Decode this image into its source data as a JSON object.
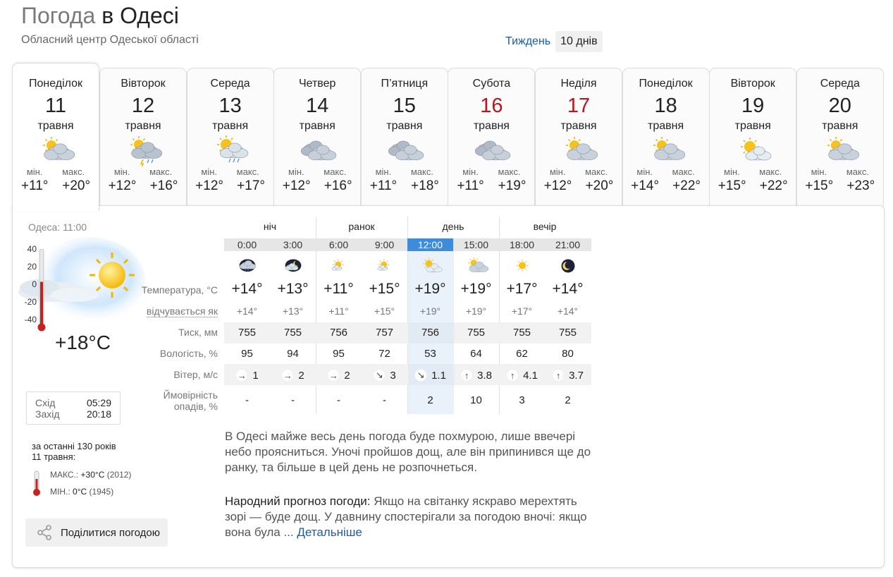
{
  "header": {
    "title_prefix": "Погода",
    "title_suffix": "в Одесі",
    "subtitle": "Обласний центр Одеської області",
    "view_tabs": [
      "Тиждень",
      "10 днів"
    ]
  },
  "days": [
    {
      "name": "Понеділок",
      "num": "11",
      "month": "травня",
      "icon": "cloudy-sun",
      "min_label": "мін.",
      "max_label": "макс.",
      "min": "+11°",
      "max": "+20°",
      "weekend": false,
      "active": true
    },
    {
      "name": "Вівторок",
      "num": "12",
      "month": "травня",
      "icon": "cloudy-sun-storm",
      "min_label": "мін.",
      "max_label": "макс.",
      "min": "+12°",
      "max": "+16°",
      "weekend": false
    },
    {
      "name": "Середа",
      "num": "13",
      "month": "травня",
      "icon": "sun-rain",
      "min_label": "мін.",
      "max_label": "макс.",
      "min": "+12°",
      "max": "+17°",
      "weekend": false
    },
    {
      "name": "Четвер",
      "num": "14",
      "month": "травня",
      "icon": "cloudy",
      "min_label": "мін.",
      "max_label": "макс.",
      "min": "+12°",
      "max": "+16°",
      "weekend": false
    },
    {
      "name": "П’ятниця",
      "num": "15",
      "month": "травня",
      "icon": "cloudy",
      "min_label": "мін.",
      "max_label": "макс.",
      "min": "+11°",
      "max": "+18°",
      "weekend": false
    },
    {
      "name": "Субота",
      "num": "16",
      "month": "травня",
      "icon": "cloudy",
      "min_label": "мін.",
      "max_label": "макс.",
      "min": "+11°",
      "max": "+19°",
      "weekend": true
    },
    {
      "name": "Неділя",
      "num": "17",
      "month": "травня",
      "icon": "cloudy-sun",
      "min_label": "мін.",
      "max_label": "макс.",
      "min": "+12°",
      "max": "+20°",
      "weekend": true
    },
    {
      "name": "Понеділок",
      "num": "18",
      "month": "травня",
      "icon": "cloudy-sun",
      "min_label": "мін.",
      "max_label": "макс.",
      "min": "+14°",
      "max": "+22°",
      "weekend": false
    },
    {
      "name": "Вівторок",
      "num": "19",
      "month": "травня",
      "icon": "sun-cloud",
      "min_label": "мін.",
      "max_label": "макс.",
      "min": "+15°",
      "max": "+22°",
      "weekend": false
    },
    {
      "name": "Середа",
      "num": "20",
      "month": "травня",
      "icon": "cloudy-sun",
      "min_label": "мін.",
      "max_label": "макс.",
      "min": "+15°",
      "max": "+23°",
      "weekend": false
    }
  ],
  "now": {
    "label": "Одеса: 11:00",
    "scale": [
      "40",
      "20",
      "0",
      "-20",
      "-40"
    ],
    "temp": "+18°C",
    "thermo_level": 0.58,
    "sunrise_label": "Схід",
    "sunrise": "05:29",
    "sunset_label": "Захід",
    "sunset": "20:18"
  },
  "history": {
    "line1": "за останні 130 років",
    "line2": "11 травня:",
    "max_label": "МАКС.:",
    "max_value": "+30°C",
    "max_year": "(2012)",
    "min_label": "МІН.:",
    "min_value": "0°C",
    "min_year": "(1945)"
  },
  "share_label": "Поділитися погодою",
  "detail": {
    "segments": [
      "ніч",
      "ранок",
      "день",
      "вечір"
    ],
    "row_labels": {
      "temp": "Температура, °C",
      "feels": "відчувається як",
      "pressure": "Тиск, мм",
      "humidity": "Вологість, %",
      "wind": "Вітер, м/с",
      "precip_1": "Ймовірність",
      "precip_2": "опадів, %"
    },
    "hours": [
      {
        "time": "0:00",
        "icon": "night-rain-cloud",
        "temp": "+14°",
        "feels": "+14°",
        "pressure": "755",
        "humidity": "95",
        "wind_dir": "→",
        "wind": "1",
        "precip": "-"
      },
      {
        "time": "3:00",
        "icon": "night-cloud-moon",
        "temp": "+13°",
        "feels": "+13°",
        "pressure": "755",
        "humidity": "94",
        "wind_dir": "→",
        "wind": "2",
        "precip": "-"
      },
      {
        "time": "6:00",
        "icon": "sun-small-cloud",
        "temp": "+11°",
        "feels": "+11°",
        "pressure": "756",
        "humidity": "95",
        "wind_dir": "→",
        "wind": "2",
        "precip": "-"
      },
      {
        "time": "9:00",
        "icon": "sun-small-cloud",
        "temp": "+15°",
        "feels": "+15°",
        "pressure": "757",
        "humidity": "72",
        "wind_dir": "↘",
        "wind": "3",
        "precip": "-"
      },
      {
        "time": "12:00",
        "icon": "sun-cloud",
        "temp": "+19°",
        "feels": "+19°",
        "pressure": "756",
        "humidity": "53",
        "wind_dir": "↘",
        "wind": "1.1",
        "precip": "2",
        "now": true
      },
      {
        "time": "15:00",
        "icon": "cloudy-sun",
        "temp": "+19°",
        "feels": "+19°",
        "pressure": "755",
        "humidity": "64",
        "wind_dir": "↑",
        "wind": "3.8",
        "precip": "10"
      },
      {
        "time": "18:00",
        "icon": "sun",
        "temp": "+17°",
        "feels": "+17°",
        "pressure": "755",
        "humidity": "62",
        "wind_dir": "↑",
        "wind": "4.1",
        "precip": "3"
      },
      {
        "time": "21:00",
        "icon": "moon",
        "temp": "+14°",
        "feels": "+14°",
        "pressure": "755",
        "humidity": "80",
        "wind_dir": "↑",
        "wind": "3.7",
        "precip": "2"
      }
    ]
  },
  "description": "В Одесі майже весь день погода буде похмурою, лише ввечері небо проясниться. Уночі пройшов дощ, але він припинився ще до ранку, та більше в цей день не розпочнеться.",
  "folk": {
    "label": "Народний прогноз погоди:",
    "text": " Якщо на світанку яскраво мерехтять зорі — буде дощ. У давнину спостерігали за погодою вночі: якщо вона була ... ",
    "link": "Детальніше"
  },
  "colors": {
    "link": "#1e5aa8",
    "weekend": "#c0141c",
    "now_hour": "#3d8bd9",
    "thermo": "#c8201f"
  }
}
